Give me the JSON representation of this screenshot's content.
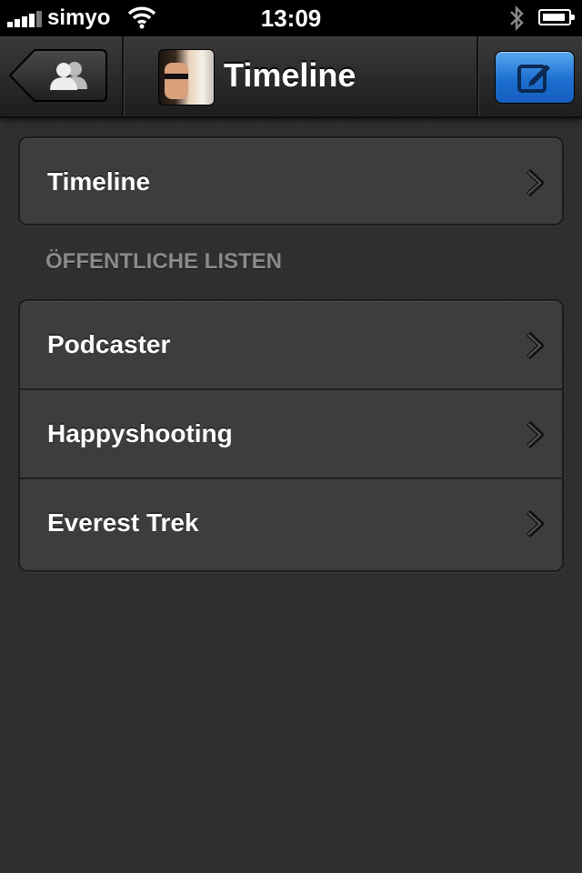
{
  "statusbar": {
    "carrier": "simyo",
    "time": "13:09"
  },
  "navbar": {
    "back_icon": "users-icon",
    "title": "Timeline",
    "compose_icon": "compose-icon"
  },
  "main_group": {
    "items": [
      {
        "label": "Timeline"
      }
    ]
  },
  "public_lists": {
    "header": "ÖFFENTLICHE LISTEN",
    "items": [
      {
        "label": "Podcaster"
      },
      {
        "label": "Happyshooting"
      },
      {
        "label": "Everest Trek"
      }
    ]
  },
  "colors": {
    "background": "#2e2e2e",
    "cell": "#3d3d3d",
    "accent": "#1c6fd0"
  }
}
